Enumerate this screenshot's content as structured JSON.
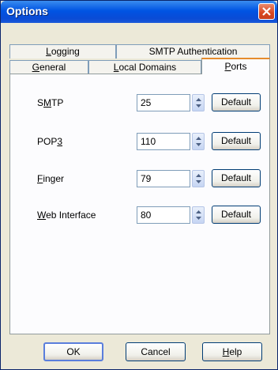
{
  "window": {
    "title": "Options"
  },
  "tabs_back": [
    {
      "label": "Logging",
      "accel": "L",
      "rest": "ogging"
    },
    {
      "label": "SMTP Authentication",
      "accel": "",
      "rest": "SMTP Authentication"
    }
  ],
  "tabs_front": [
    {
      "label": "General",
      "accel": "G",
      "rest": "eneral"
    },
    {
      "label": "Local Domains",
      "accel": "L",
      "rest": "ocal Domains"
    },
    {
      "label": "Ports",
      "accel": "P",
      "rest": "orts",
      "active": true
    }
  ],
  "ports": [
    {
      "label": "SMTP",
      "pre": "S",
      "accel": "M",
      "post": "TP",
      "value": "25",
      "button": "Default"
    },
    {
      "label": "POP3",
      "pre": "POP",
      "accel": "3",
      "post": "",
      "value": "110",
      "button": "Default"
    },
    {
      "label": "Finger",
      "pre": "",
      "accel": "F",
      "post": "inger",
      "value": "79",
      "button": "Default"
    },
    {
      "label": "Web Interface",
      "pre": "",
      "accel": "W",
      "post": "eb Interface",
      "value": "80",
      "button": "Default"
    }
  ],
  "buttons": {
    "ok": "OK",
    "cancel": "Cancel",
    "help_accel": "H",
    "help_rest": "elp"
  },
  "colors": {
    "titlebar": "#0054e3",
    "close": "#d9461f",
    "active_tab_accent": "#e68b2c",
    "face": "#ece9d8"
  }
}
